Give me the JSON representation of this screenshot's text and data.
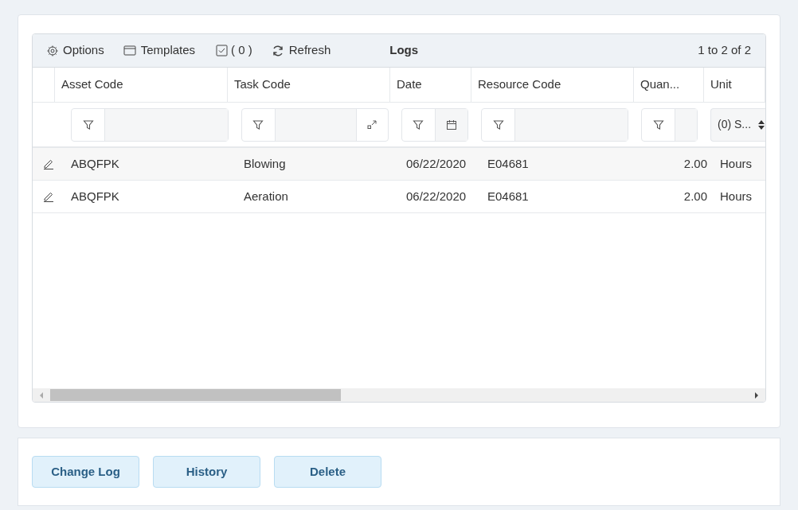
{
  "toolbar": {
    "options": "Options",
    "templates": "Templates",
    "selected_count": "( 0 )",
    "refresh": "Refresh",
    "title": "Logs",
    "range": "1 to 2 of 2"
  },
  "columns": [
    {
      "label": "Asset Code",
      "kind": "text"
    },
    {
      "label": "Task Code",
      "kind": "expand"
    },
    {
      "label": "Date",
      "kind": "date"
    },
    {
      "label": "Resource Code",
      "kind": "text"
    },
    {
      "label": "Quan...",
      "kind": "number"
    },
    {
      "label": "Unit",
      "kind": "select",
      "filter_value": "(0) S..."
    }
  ],
  "rows": [
    {
      "cells": [
        "ABQFPK",
        "Blowing",
        "06/22/2020",
        "E04681",
        "2.00",
        "Hours"
      ]
    },
    {
      "cells": [
        "ABQFPK",
        "Aeration",
        "06/22/2020",
        "E04681",
        "2.00",
        "Hours"
      ]
    }
  ],
  "buttons": [
    "Change Log",
    "History",
    "Delete"
  ]
}
